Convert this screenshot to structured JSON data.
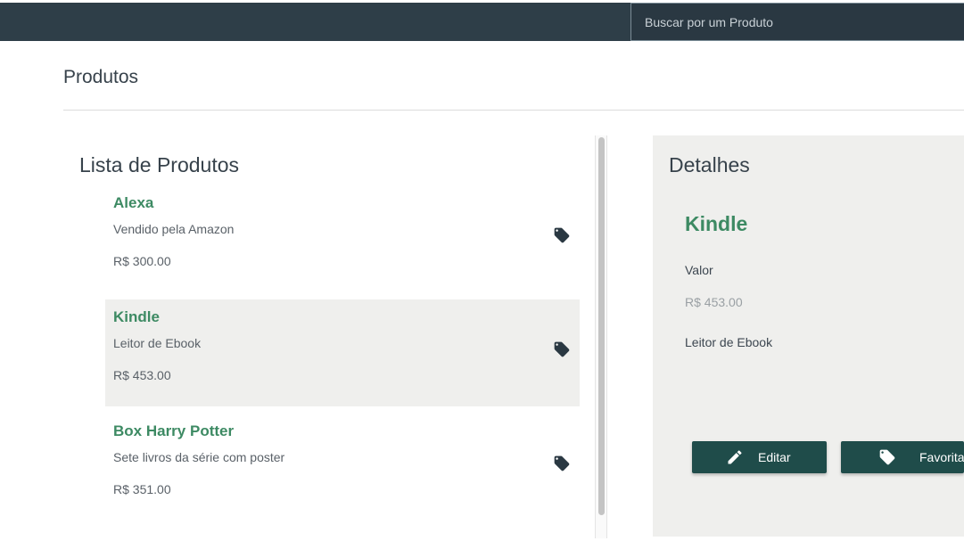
{
  "header": {
    "search_placeholder": "Buscar por um Produto"
  },
  "page": {
    "title": "Produtos"
  },
  "list": {
    "title": "Lista de Produtos",
    "items": [
      {
        "name": "Alexa",
        "description": "Vendido pela Amazon",
        "price": "R$ 300.00",
        "icon": "tag-icon",
        "selected": false
      },
      {
        "name": "Kindle",
        "description": "Leitor de Ebook",
        "price": "R$ 453.00",
        "icon": "tag-icon",
        "selected": true
      },
      {
        "name": "Box Harry Potter",
        "description": "Sete livros da série com poster",
        "price": "R$ 351.00",
        "icon": "tag-icon",
        "selected": false
      }
    ]
  },
  "details": {
    "title": "Detalhes",
    "product_name": "Kindle",
    "value_label": "Valor",
    "value": "R$ 453.00",
    "description": "Leitor de Ebook",
    "edit_label": "Editar",
    "edit_icon": "pencil-icon",
    "favorite_label": "Favoritar",
    "favorite_icon": "tag-icon"
  },
  "colors": {
    "topbar": "#2e3e48",
    "accent_green": "#3d8a63",
    "button": "#1f4c4a",
    "selected_row": "#efefed"
  }
}
